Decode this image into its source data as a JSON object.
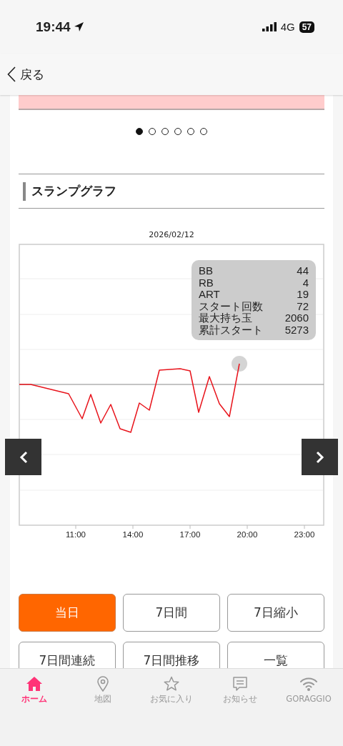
{
  "status_bar": {
    "time": "19:44",
    "network": "4G",
    "battery": "57"
  },
  "header": {
    "back_label": "戻る"
  },
  "pager": {
    "dots": [
      {
        "selected": true
      },
      {
        "selected": false
      },
      {
        "selected": false
      },
      {
        "selected": false
      },
      {
        "selected": false
      },
      {
        "selected": false
      }
    ]
  },
  "section": {
    "title": "スランプグラフ"
  },
  "chart": {
    "title": "2026/02/12",
    "x_tick_labels": [
      "11:00",
      "14:00",
      "17:00",
      "20:00",
      "23:00"
    ],
    "tooltip": [
      {
        "label": "BB",
        "value": "44"
      },
      {
        "label": "RB",
        "value": "4"
      },
      {
        "label": "ART",
        "value": "19"
      },
      {
        "label": "スタート回数",
        "value": "72"
      },
      {
        "label": "最大持ち玉",
        "value": "2060"
      },
      {
        "label": "累計スタート",
        "value": "5273"
      }
    ]
  },
  "range_buttons": [
    {
      "label": "当日",
      "selected": true
    },
    {
      "label": "7日間",
      "selected": false
    },
    {
      "label": "7日縮小",
      "selected": false
    },
    {
      "label": "7日間連続",
      "selected": false
    },
    {
      "label": "7日間推移",
      "selected": false
    },
    {
      "label": "一覧",
      "selected": false
    }
  ],
  "tab_bar": [
    {
      "kind": "home",
      "label": "ホーム",
      "selected": true
    },
    {
      "kind": "map",
      "label": "地図",
      "selected": false
    },
    {
      "kind": "favorite",
      "label": "お気に入り",
      "selected": false
    },
    {
      "kind": "news",
      "label": "お知らせ",
      "selected": false
    },
    {
      "kind": "wifi",
      "label": "GORAGGIO",
      "selected": false
    }
  ]
}
